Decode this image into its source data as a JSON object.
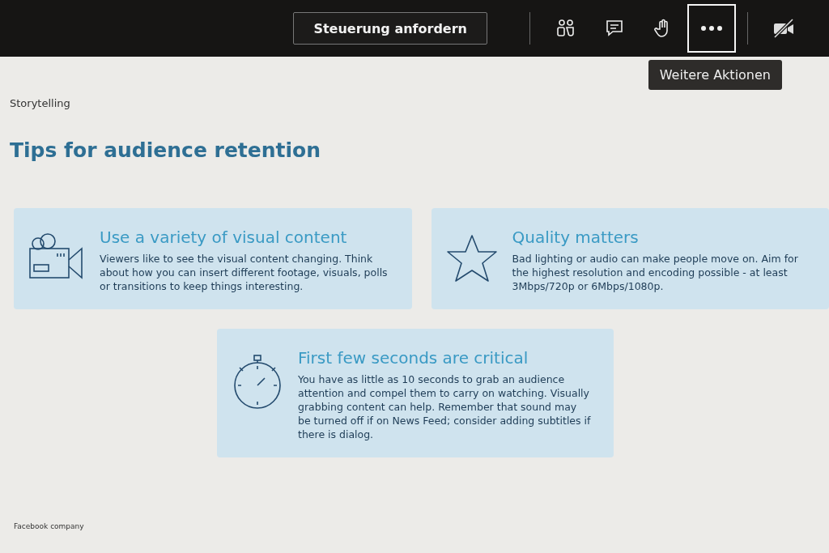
{
  "toolbar": {
    "request_button": "Steuerung anfordern",
    "buttons": [
      {
        "kind": "people",
        "selected": false
      },
      {
        "kind": "chat",
        "selected": false
      },
      {
        "kind": "hand",
        "selected": false
      },
      {
        "kind": "more",
        "selected": true
      },
      {
        "kind": "camera-off",
        "selected": false
      }
    ],
    "tooltip": "Weitere Aktionen"
  },
  "slide": {
    "section": "Storytelling",
    "title": "Tips for audience retention",
    "cards": [
      {
        "kind": "camera",
        "title": "Use a variety of visual content",
        "text": "Viewers like to see the visual content changing. Think about how you can insert different footage, visuals, polls or transitions to keep things interesting."
      },
      {
        "kind": "star",
        "title": "Quality matters",
        "text": "Bad lighting or audio can make people move on. Aim for the highest resolution and encoding possible - at least 3Mbps/720p or 6Mbps/1080p."
      },
      {
        "kind": "stopwatch",
        "title": "First few seconds are critical",
        "text": "You have as little as 10 seconds to grab an audience attention and compel them to carry on watching. Visually grabbing content can help. Remember that sound may be turned off if on News Feed; consider adding subtitles if there is dialog."
      }
    ],
    "footer": "Facebook company"
  }
}
